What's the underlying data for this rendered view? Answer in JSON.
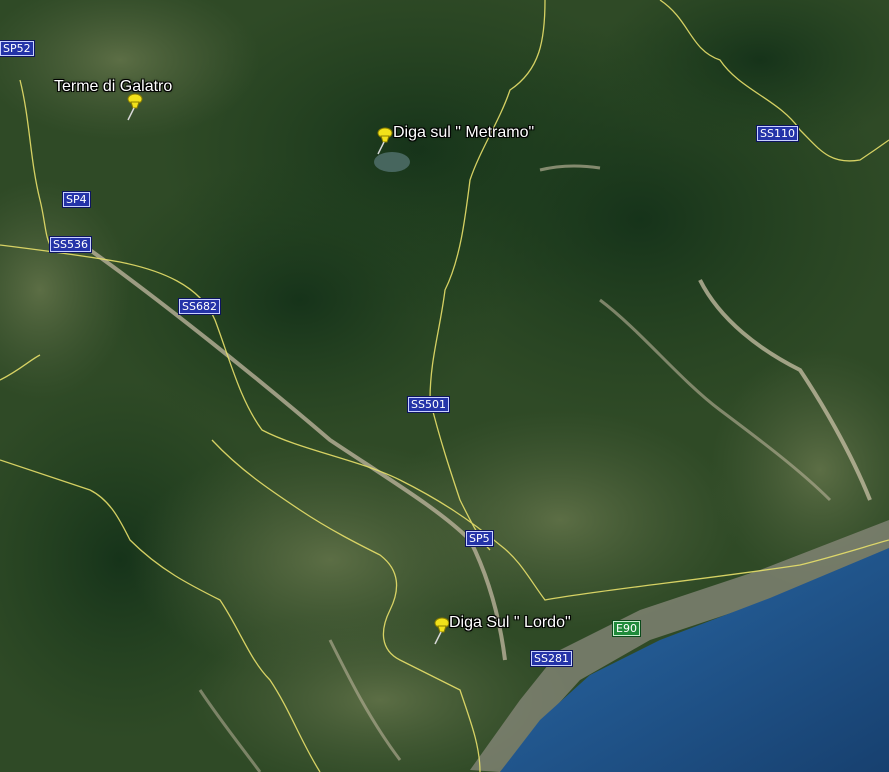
{
  "placemarks": [
    {
      "id": "galatro",
      "name": "Terme di Galatro",
      "icon": "yellow-pushpin-icon"
    },
    {
      "id": "metramo",
      "name": "Diga sul \" Metramo\"",
      "icon": "yellow-pushpin-icon"
    },
    {
      "id": "lordo",
      "name": "Diga Sul \" Lordo\"",
      "icon": "yellow-pushpin-icon"
    }
  ],
  "road_shields": {
    "sp52": "SP52",
    "sp4": "SP4",
    "ss536": "SS536",
    "ss682": "SS682",
    "ss501": "SS501",
    "sp5": "SP5",
    "ss110": "SS110",
    "e90": "E90",
    "ss281": "SS281"
  },
  "colors": {
    "forest": "#24461f",
    "sea": "#1e4f8c",
    "border_line": "#e8e06a",
    "shield_blue": "#2433a8",
    "shield_green": "#1f8a3a",
    "pin_yellow": "#f2e21a"
  }
}
